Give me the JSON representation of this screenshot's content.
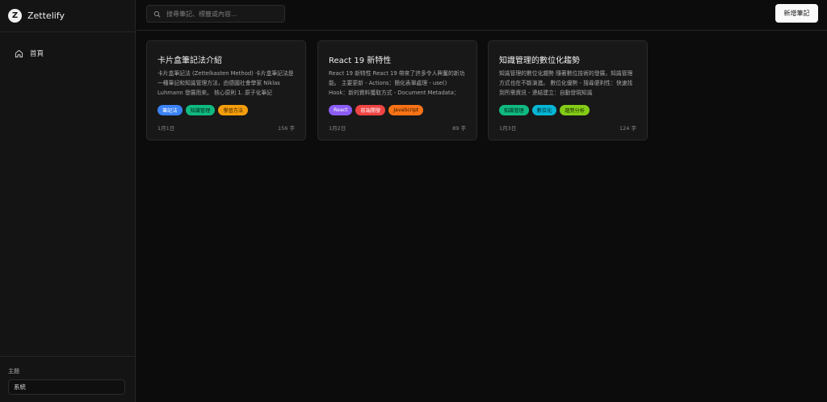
{
  "brand": {
    "logo_letter": "Z",
    "name": "Zettelify"
  },
  "sidebar": {
    "items": [
      {
        "label": "首頁",
        "icon": "home-icon"
      }
    ],
    "theme_label": "主題",
    "theme_value": "系統"
  },
  "header": {
    "search_placeholder": "搜尋筆記、標籤或內容...",
    "new_button_label": "新增筆記"
  },
  "notes": [
    {
      "title": "卡片盒筆記法介紹",
      "excerpt": "卡片盒筆記法 (Zettelkasten Method) 卡片盒筆記法是一種筆記和知識管理方法，由德國社會學家 Niklas Luhmann 發展而來。 核心原則 1. 原子化筆記",
      "tags": [
        {
          "label": "筆記法",
          "color": "#3b82f6",
          "text": "#ffffff"
        },
        {
          "label": "知識管理",
          "color": "#10b981",
          "text": "#06281c"
        },
        {
          "label": "學習方法",
          "color": "#f59e0b",
          "text": "#3a2300"
        }
      ],
      "date": "1月1日",
      "words": "156 字"
    },
    {
      "title": "React 19 新特性",
      "excerpt": "React 19 新特性 React 19 帶來了許多令人興奮的新功能。 主要更新 - Actions：簡化表單處理 - use() Hook：新的資料獲取方式 - Document Metadata：",
      "tags": [
        {
          "label": "React",
          "color": "#8b5cf6",
          "text": "#ffffff"
        },
        {
          "label": "前端開發",
          "color": "#ef4444",
          "text": "#ffffff"
        },
        {
          "label": "JavaScript",
          "color": "#f97316",
          "text": "#2a1200"
        }
      ],
      "date": "1月2日",
      "words": "89 字"
    },
    {
      "title": "知識管理的數位化趨勢",
      "excerpt": "知識管理的數位化趨勢 隨著數位技術的發展，知識管理方式也在不斷演進。 數位化優勢 - 搜尋便利性：快速找到所需資訊 - 連結建立：自動發現知識",
      "tags": [
        {
          "label": "知識管理",
          "color": "#10b981",
          "text": "#06281c"
        },
        {
          "label": "數位化",
          "color": "#06b6d4",
          "text": "#03262d"
        },
        {
          "label": "趨勢分析",
          "color": "#84cc16",
          "text": "#1c2a04"
        }
      ],
      "date": "1月3日",
      "words": "124 字"
    }
  ]
}
